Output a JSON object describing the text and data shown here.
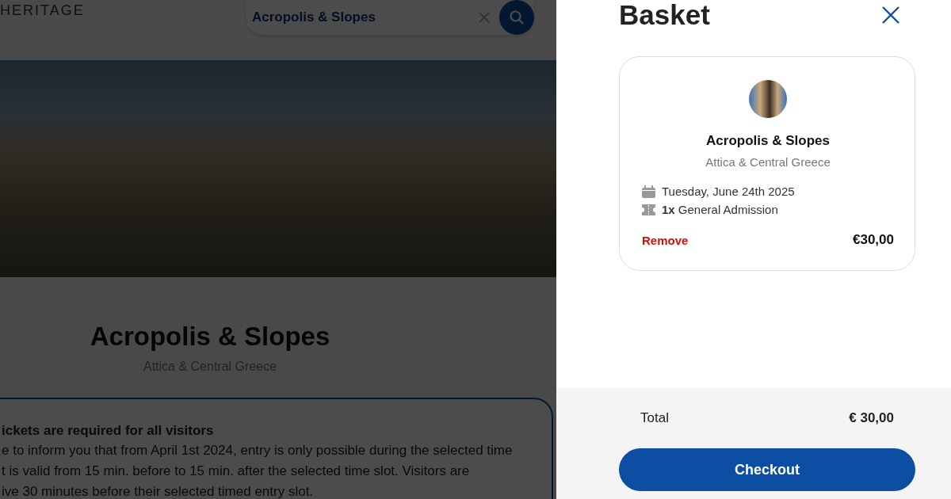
{
  "background_page": {
    "logo": "HERITAGE",
    "search": {
      "value": "Acropolis & Slopes"
    },
    "title": "Acropolis & Slopes",
    "subtitle": "Attica & Central Greece",
    "notice": {
      "heading": "ickets are required for all visitors",
      "lines": [
        "e to inform you that from April 1st 2024, entry is only possible during the selected time",
        "t is valid from 15 min. before to 15 min. after the selected time slot. Visitors are",
        "ive 30 minutes before their selected timed entry slot."
      ]
    }
  },
  "basket": {
    "title": "Basket",
    "items": [
      {
        "name": "Acropolis & Slopes",
        "region": "Attica & Central Greece",
        "date": "Tuesday, June 24th 2025",
        "quantity": "1x",
        "ticket_type": "General Admission",
        "remove": "Remove",
        "price": "€30,00"
      }
    ],
    "total_label": "Total",
    "total": "€ 30,00",
    "checkout": "Checkout"
  }
}
